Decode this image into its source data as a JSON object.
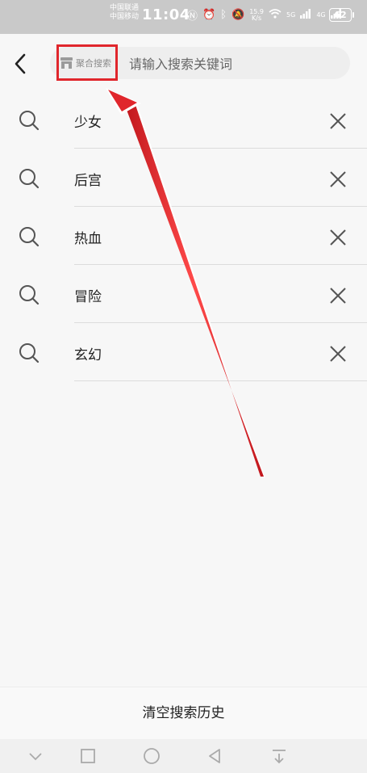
{
  "status_bar": {
    "carrier_1": "中国联通",
    "carrier_2": "中国移动",
    "time": "11:04",
    "net_speed_value": "15.9",
    "net_speed_unit": "K/s",
    "sim1_type": "5G",
    "sim2_type": "4G",
    "battery": "62"
  },
  "header": {
    "aggregate_label": "聚合搜索",
    "search_placeholder": "请输入搜索关键词"
  },
  "history": [
    {
      "term": "少女"
    },
    {
      "term": "后宫"
    },
    {
      "term": "热血"
    },
    {
      "term": "冒险"
    },
    {
      "term": "玄幻"
    }
  ],
  "footer": {
    "clear_label": "清空搜索历史"
  },
  "colors": {
    "highlight": "#e0262c",
    "status_bar_bg": "#c9c9c9"
  }
}
